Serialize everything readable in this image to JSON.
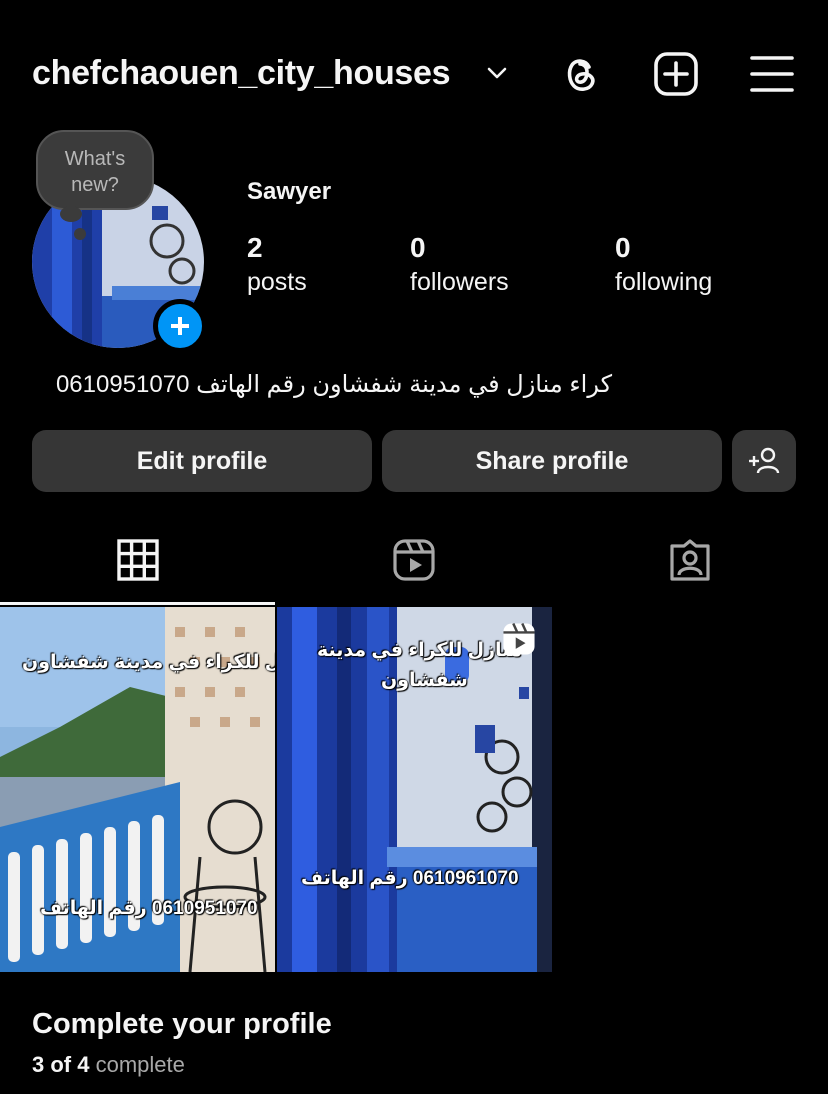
{
  "header": {
    "username": "chefchaouen_city_houses",
    "icons": [
      "chevron-down-icon",
      "threads-icon",
      "create-post-icon",
      "menu-icon"
    ]
  },
  "profile": {
    "note_bubble_line1": "What's",
    "note_bubble_line2": "new?",
    "display_name": "Sawyer",
    "stats": {
      "posts_count": "2",
      "posts_label": "posts",
      "followers_count": "0",
      "followers_label": "followers",
      "following_count": "0",
      "following_label": "following"
    },
    "bio": "كراء منازل في مدينة شفشاون رقم الهاتف 0610951070"
  },
  "actions": {
    "edit_label": "Edit profile",
    "share_label": "Share profile",
    "discover_icon": "add-person-icon"
  },
  "tabs": {
    "items": [
      "grid-icon",
      "reels-icon",
      "tagged-icon"
    ],
    "active": "grid"
  },
  "posts": [
    {
      "caption_top": "منازل للكراء في مدينة شفشاون",
      "caption_bottom": "0610951070 رقم الهاتف",
      "type": "image"
    },
    {
      "caption_top_line1": "منازل للكراء في مدينة",
      "caption_top_line2": "شفشاون",
      "caption_bottom": "0610961070 رقم الهاتف",
      "type": "reel",
      "badge_icon": "reel-badge-icon"
    }
  ],
  "completion": {
    "title": "Complete your profile",
    "progress_bold": "3 of 4",
    "progress_suffix": "complete",
    "done": 3,
    "total": 4
  },
  "colors": {
    "background": "#000000",
    "button": "#363636",
    "accent_blue": "#0095f6",
    "muted": "#a8a8a8"
  }
}
